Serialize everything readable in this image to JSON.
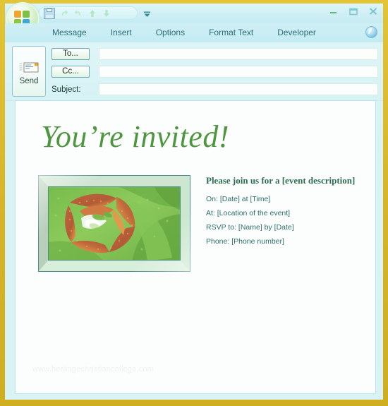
{
  "window": {
    "orb_name": "office-button",
    "quick_access": {
      "items": [
        {
          "name": "save-icon",
          "label": "Save"
        },
        {
          "name": "undo-icon",
          "label": "Undo"
        },
        {
          "name": "redo-icon",
          "label": "Redo"
        },
        {
          "name": "previous-item-icon",
          "label": "Previous Item"
        },
        {
          "name": "next-item-icon",
          "label": "Next Item"
        }
      ],
      "more_label": "Customize Quick Access Toolbar"
    },
    "controls": [
      {
        "name": "minimize-button",
        "label": "Minimize"
      },
      {
        "name": "restore-button",
        "label": "Restore"
      },
      {
        "name": "close-button",
        "label": "Close"
      }
    ]
  },
  "ribbon": {
    "tabs": [
      {
        "label": "Message"
      },
      {
        "label": "Insert"
      },
      {
        "label": "Options"
      },
      {
        "label": "Format Text"
      },
      {
        "label": "Developer"
      }
    ],
    "help_label": "Help"
  },
  "compose": {
    "send_label": "Send",
    "to_label": "To...",
    "cc_label": "Cc...",
    "subject_label": "Subject:",
    "to_value": "",
    "cc_value": "",
    "subject_value": "",
    "to_placeholder": "",
    "cc_placeholder": "",
    "subject_placeholder": ""
  },
  "invitation": {
    "title": "You’re invited!",
    "heading": "Please join us for a [event description]",
    "details": [
      "On:  [Date] at [Time]",
      "At:  [Location of the event]",
      "RSVP to:  [Name] by [Date]",
      "Phone:  [Phone number]"
    ],
    "watermark": "www.heritagechristiancollege.com",
    "image_alt": "flower-photo"
  },
  "colors": {
    "window_frame": "#d9b829",
    "chrome": "#cdeef4",
    "title_green": "#4e9640",
    "heading_green": "#2e6e4f",
    "detail_teal": "#2e6e6a",
    "body_background": "#fcfefd"
  }
}
